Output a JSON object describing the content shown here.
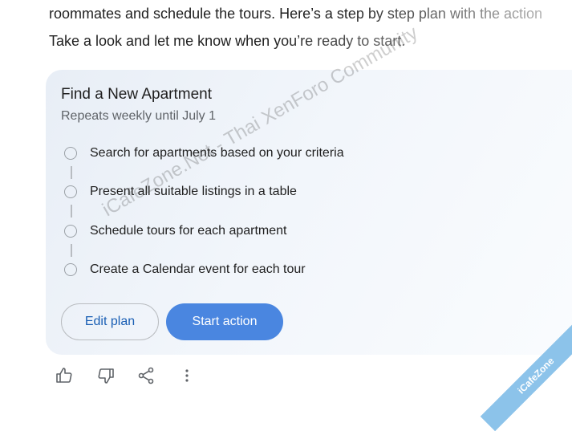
{
  "intro": {
    "line1": "roommates and schedule the tours. Here’s a step by step plan with the action",
    "line2": "Take a look and let me know when you’re ready to start."
  },
  "card": {
    "title": "Find a New Apartment",
    "subtitle": "Repeats weekly until July 1",
    "steps": [
      {
        "label": "Search for apartments based on your criteria"
      },
      {
        "label": "Present all suitable listings in a table"
      },
      {
        "label": "Schedule tours for each apartment"
      },
      {
        "label": "Create a Calendar event for each tour"
      }
    ],
    "edit_label": "Edit plan",
    "start_label": "Start action"
  },
  "actions": {
    "icons": [
      "thumbs-up-icon",
      "thumbs-down-icon",
      "share-icon",
      "more-vert-icon"
    ]
  },
  "watermark": {
    "text": "iCafeZone.Net - Thai XenForo Community",
    "badge": "iCafeZone"
  },
  "colors": {
    "accent": "#4a86e0",
    "link": "#1a5fb4",
    "card_bg": "#eef3f9",
    "badge": "#8cc3ea"
  }
}
